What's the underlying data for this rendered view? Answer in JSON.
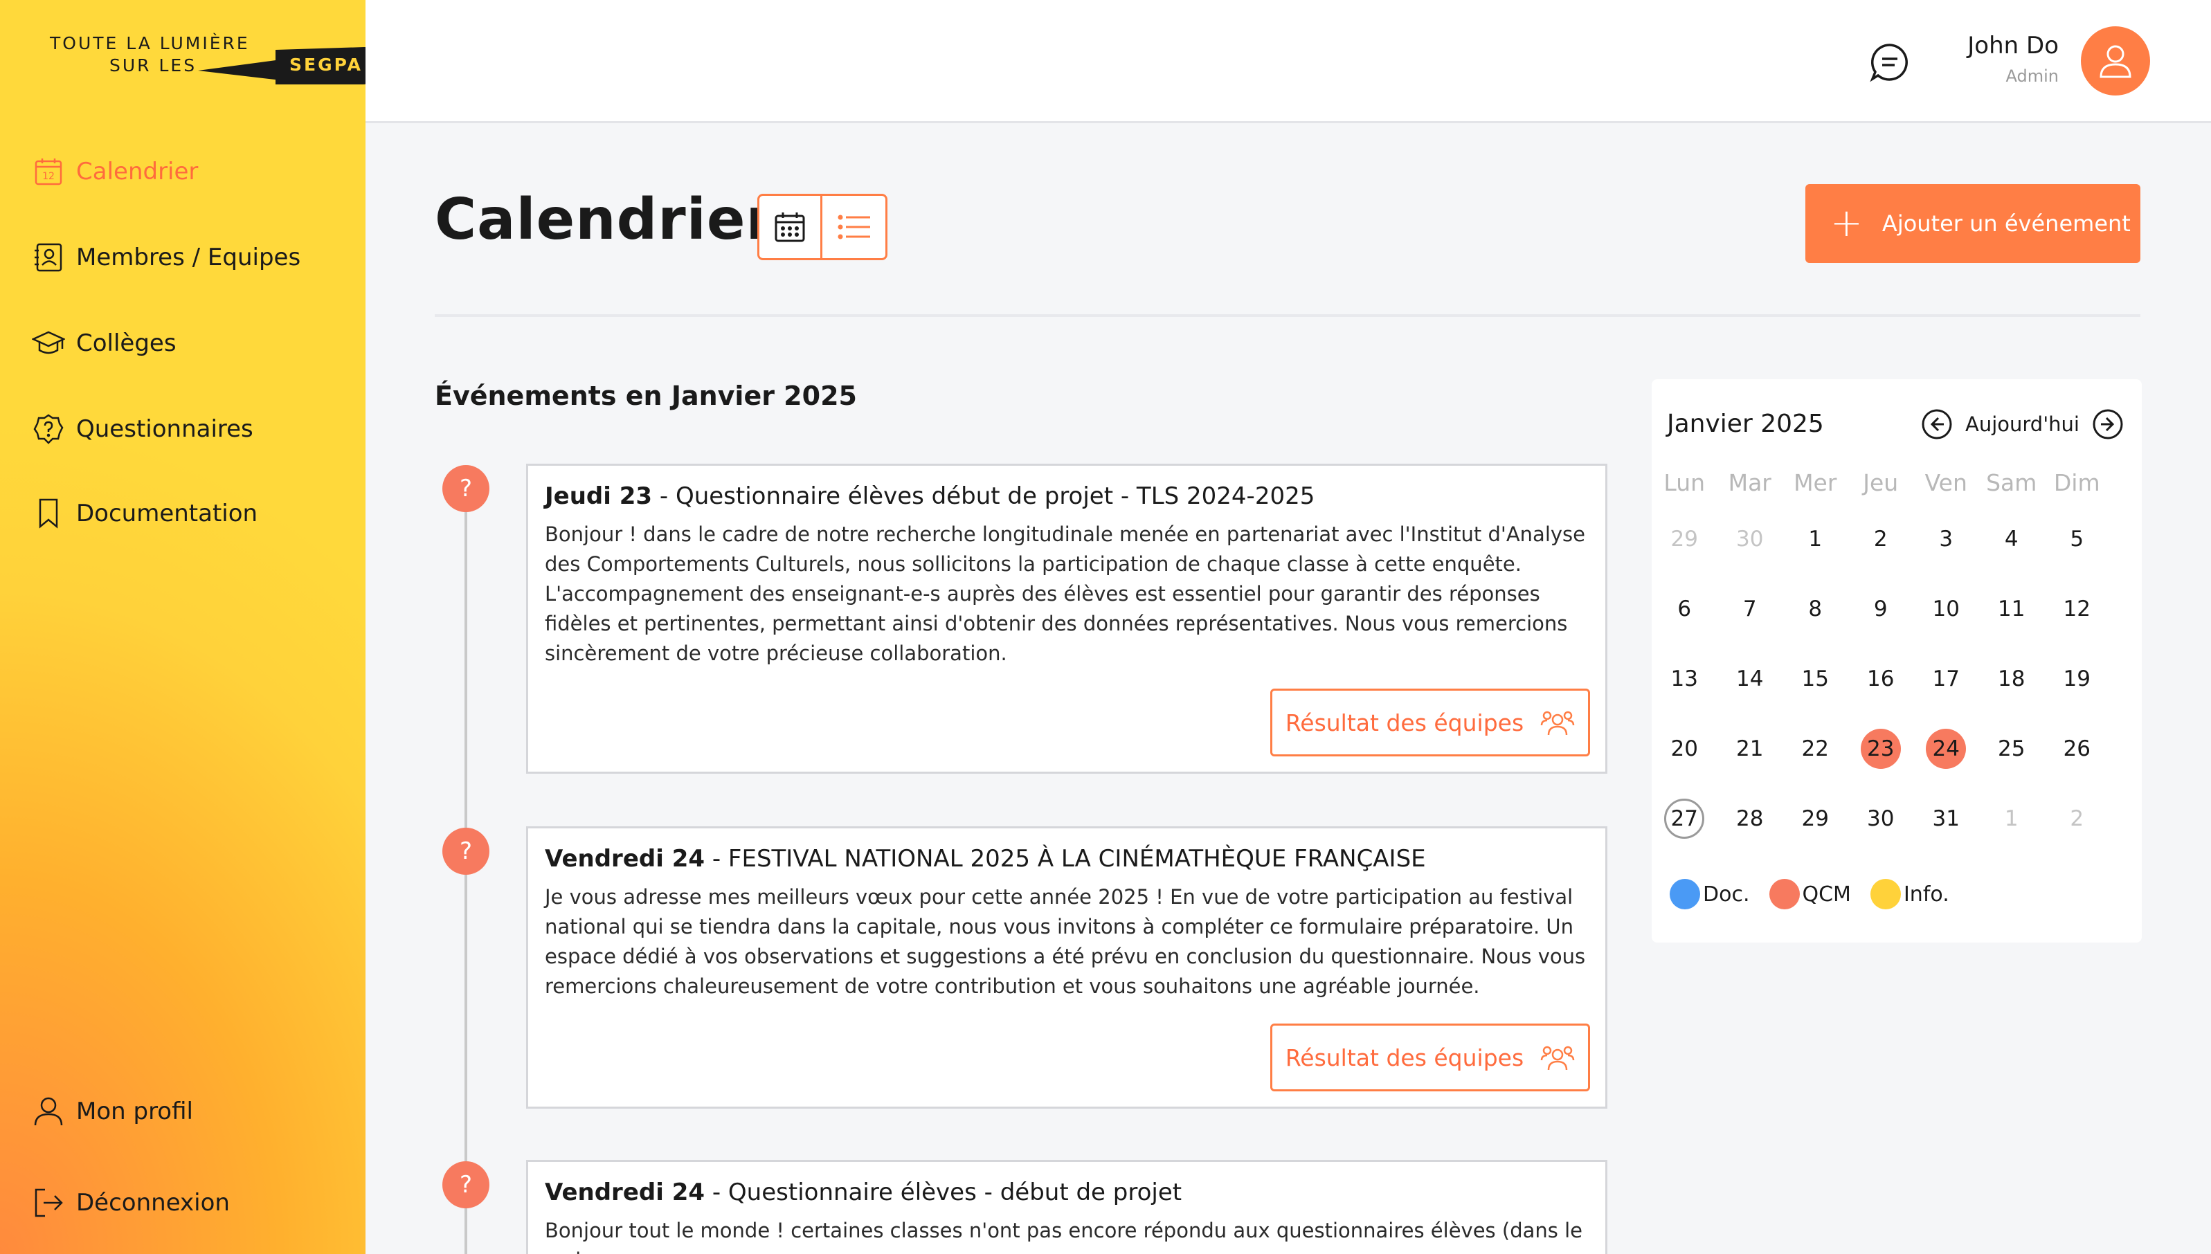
{
  "brand": {
    "line1": "TOUTE LA LUMIÈRE",
    "line2": "SUR LES",
    "badge": "SEGPA"
  },
  "nav": {
    "items": [
      {
        "label": "Calendrier",
        "icon": "calendar-icon",
        "active": true
      },
      {
        "label": "Membres / Equipes",
        "icon": "contacts-icon"
      },
      {
        "label": "Collèges",
        "icon": "graduation-cap-icon"
      },
      {
        "label": "Questionnaires",
        "icon": "question-badge-icon"
      },
      {
        "label": "Documentation",
        "icon": "bookmark-icon"
      }
    ],
    "bottom": [
      {
        "label": "Mon profil",
        "icon": "user-icon"
      },
      {
        "label": "Déconnexion",
        "icon": "logout-icon"
      }
    ]
  },
  "header": {
    "user_name": "John Do",
    "user_role": "Admin"
  },
  "main": {
    "title": "Calendrier",
    "add_button": "Ajouter un événement",
    "events_heading": "Événements en Janvier 2025",
    "events": [
      {
        "day": "Jeudi 23",
        "title": "Questionnaire élèves début de projet - TLS 2024-2025",
        "body": "Bonjour ! dans le cadre de notre recherche longitudinale menée en partenariat avec l'Institut d'Analyse des Comportements Culturels, nous sollicitons la participation de chaque classe à cette enquête. L'accompagnement des enseignant-e-s auprès des élèves est essentiel pour garantir des réponses fidèles et pertinentes, permettant ainsi d'obtenir des données représentatives. Nous vous remercions sincèrement de votre précieuse collaboration.",
        "button": "Résultat des équipes",
        "marker": "?"
      },
      {
        "day": "Vendredi 24",
        "title": "FESTIVAL NATIONAL 2025  À LA CINÉMATHÈQUE FRANÇAISE",
        "body": "Je vous adresse mes meilleurs vœux pour cette année 2025 ! En vue de votre participation au festival national qui se tiendra dans la capitale, nous vous invitons à compléter ce formulaire préparatoire. Un espace dédié à vos observations et suggestions a été prévu en conclusion du questionnaire. Nous vous remercions chaleureusement de votre contribution et vous souhaitons une agréable journée.",
        "button": "Résultat des équipes",
        "marker": "?"
      },
      {
        "day": "Vendredi 24",
        "title": "Questionnaire élèves - début de projet",
        "body": "Bonjour tout le monde ! certaines classes n'ont pas encore répondu aux questionnaires élèves (dans le cadre",
        "marker": "?"
      }
    ]
  },
  "calendar": {
    "month": "Janvier 2025",
    "today_label": "Aujourd'hui",
    "weekdays": [
      "Lun",
      "Mar",
      "Mer",
      "Jeu",
      "Ven",
      "Sam",
      "Dim"
    ],
    "weeks": [
      [
        {
          "d": "29",
          "m": true
        },
        {
          "d": "30",
          "m": true
        },
        {
          "d": "1"
        },
        {
          "d": "2"
        },
        {
          "d": "3"
        },
        {
          "d": "4"
        },
        {
          "d": "5"
        }
      ],
      [
        {
          "d": "6"
        },
        {
          "d": "7"
        },
        {
          "d": "8"
        },
        {
          "d": "9"
        },
        {
          "d": "10"
        },
        {
          "d": "11"
        },
        {
          "d": "12"
        }
      ],
      [
        {
          "d": "13"
        },
        {
          "d": "14"
        },
        {
          "d": "15"
        },
        {
          "d": "16"
        },
        {
          "d": "17"
        },
        {
          "d": "18"
        },
        {
          "d": "19"
        }
      ],
      [
        {
          "d": "20"
        },
        {
          "d": "21"
        },
        {
          "d": "22"
        },
        {
          "d": "23",
          "e": true
        },
        {
          "d": "24",
          "e": true
        },
        {
          "d": "25"
        },
        {
          "d": "26"
        }
      ],
      [
        {
          "d": "27",
          "t": true
        },
        {
          "d": "28"
        },
        {
          "d": "29"
        },
        {
          "d": "30"
        },
        {
          "d": "31"
        },
        {
          "d": "1",
          "m": true
        },
        {
          "d": "2",
          "m": true
        }
      ]
    ],
    "legend": [
      {
        "label": "Doc.",
        "color": "#4a9af5"
      },
      {
        "label": "QCM",
        "color": "#f77a5f"
      },
      {
        "label": "Info.",
        "color": "#ffd23a"
      }
    ]
  },
  "colors": {
    "accent": "#ff7e45",
    "event": "#f77a5f"
  }
}
